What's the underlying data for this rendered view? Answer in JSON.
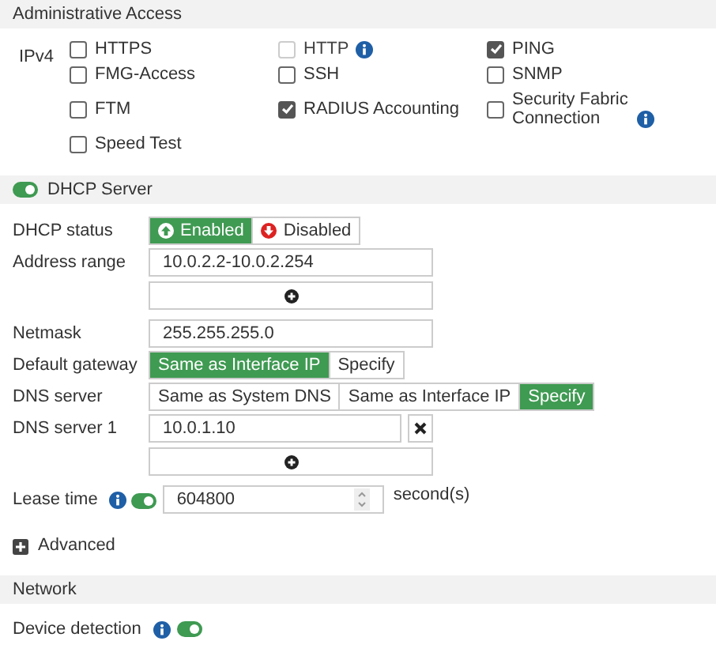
{
  "admin_access": {
    "title": "Administrative Access",
    "protocol_label": "IPv4",
    "options": [
      {
        "label": "HTTPS",
        "checked": false,
        "disabled": false,
        "info": false
      },
      {
        "label": "HTTP",
        "checked": false,
        "disabled": true,
        "info": true
      },
      {
        "label": "PING",
        "checked": true,
        "disabled": false,
        "info": false
      },
      {
        "label": "FMG-Access",
        "checked": false,
        "disabled": false,
        "info": false
      },
      {
        "label": "SSH",
        "checked": false,
        "disabled": false,
        "info": false
      },
      {
        "label": "SNMP",
        "checked": false,
        "disabled": false,
        "info": false
      },
      {
        "label": "FTM",
        "checked": false,
        "disabled": false,
        "info": false
      },
      {
        "label": "RADIUS Accounting",
        "checked": true,
        "disabled": false,
        "info": false
      },
      {
        "label": "Security Fabric Connection",
        "checked": false,
        "disabled": false,
        "info": true
      },
      {
        "label": "Speed Test",
        "checked": false,
        "disabled": false,
        "info": false
      }
    ]
  },
  "dhcp_server": {
    "title": "DHCP Server",
    "on": true,
    "status": {
      "label": "DHCP status",
      "options": [
        {
          "label": "Enabled",
          "kind": "up",
          "selected": true
        },
        {
          "label": "Disabled",
          "kind": "down",
          "selected": false
        }
      ]
    },
    "address_range": {
      "label": "Address range",
      "value": "10.0.2.2-10.0.2.254"
    },
    "netmask": {
      "label": "Netmask",
      "value": "255.255.255.0"
    },
    "default_gateway": {
      "label": "Default gateway",
      "options": [
        {
          "label": "Same as Interface IP",
          "selected": true
        },
        {
          "label": "Specify",
          "selected": false
        }
      ]
    },
    "dns_server": {
      "label": "DNS server",
      "options": [
        {
          "label": "Same as System DNS",
          "selected": false
        },
        {
          "label": "Same as Interface IP",
          "selected": false
        },
        {
          "label": "Specify",
          "selected": true
        }
      ]
    },
    "dns_server_1": {
      "label": "DNS server 1",
      "value": "10.0.1.10"
    },
    "lease_time": {
      "label": "Lease time",
      "on": true,
      "value": "604800",
      "unit": "second(s)"
    },
    "advanced": {
      "label": "Advanced",
      "expanded": false
    }
  },
  "network": {
    "title": "Network",
    "device_detection": {
      "label": "Device detection",
      "on": true
    }
  }
}
